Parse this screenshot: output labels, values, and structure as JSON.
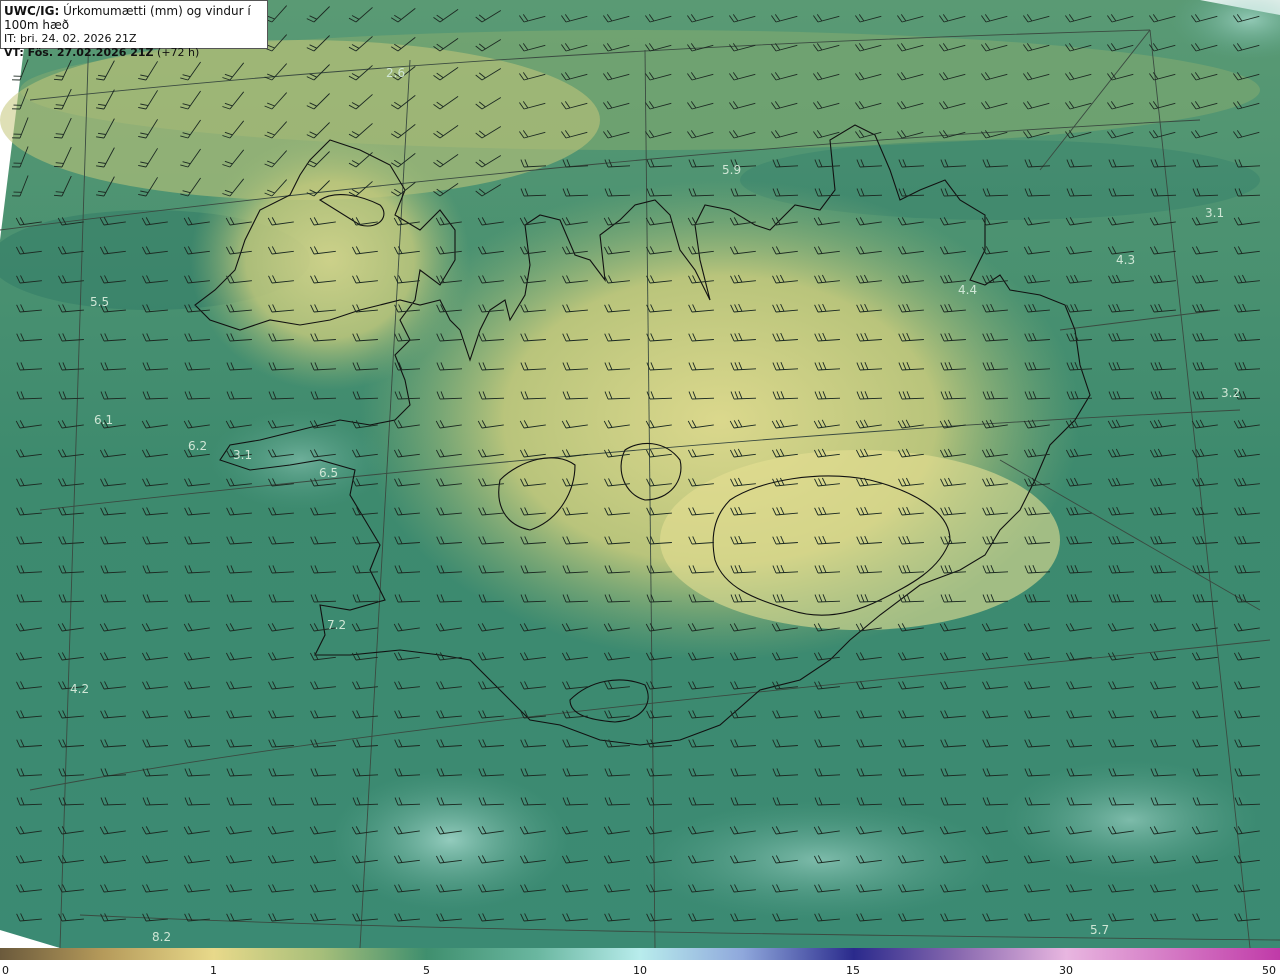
{
  "header": {
    "model": "UWC/IG:",
    "title": "Úrkomumætti (mm) og vindur í 100m hæð",
    "init_time": "IT: þri. 24. 02. 2026 21Z",
    "valid_label": "VT: Fös. 27.02.2026 21Z",
    "lead_time": "(+72 h)"
  },
  "map_value_labels": [
    {
      "text": "2.6"
    },
    {
      "text": "5.9"
    },
    {
      "text": "3.1"
    },
    {
      "text": "4.3"
    },
    {
      "text": "4.4"
    },
    {
      "text": "5.5"
    },
    {
      "text": "3.2"
    },
    {
      "text": "6.1"
    },
    {
      "text": "6.2"
    },
    {
      "text": "3.1"
    },
    {
      "text": "6.5"
    },
    {
      "text": "7.2"
    },
    {
      "text": "4.2"
    },
    {
      "text": "8.2"
    },
    {
      "text": "5.7"
    }
  ],
  "colorbar": {
    "ticks": [
      "0",
      "1",
      "5",
      "10",
      "15",
      "30",
      "50"
    ],
    "colors": {
      "low": "#6b5a3c",
      "mid_low": "#e8d98a",
      "mid": "#3f8f6e",
      "high": "#b8ecec",
      "upper": "#2a2a8c",
      "top": "#c03aa8"
    }
  },
  "colors": {
    "land_yellow": "#cfcf7a",
    "sea_green": "#3d8a6e",
    "coast_line": "#111111"
  }
}
